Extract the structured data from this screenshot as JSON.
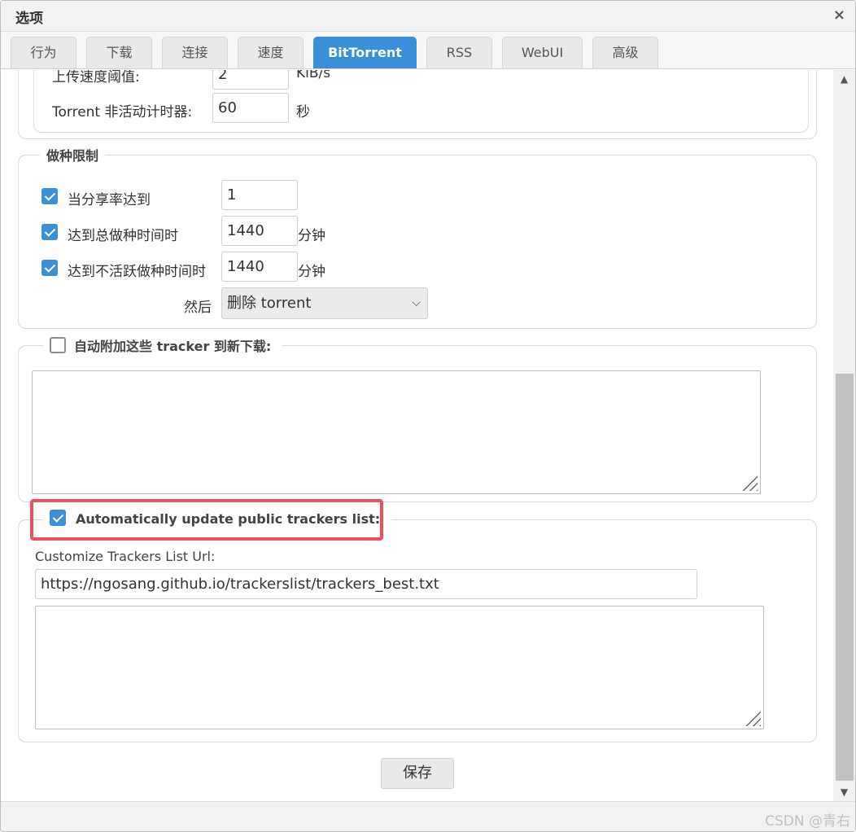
{
  "window": {
    "title": "选项",
    "close_glyph": "×"
  },
  "tabs": [
    {
      "label": "行为"
    },
    {
      "label": "下载"
    },
    {
      "label": "连接"
    },
    {
      "label": "速度"
    },
    {
      "label": "BitTorrent",
      "active": true
    },
    {
      "label": "RSS"
    },
    {
      "label": "WebUI"
    },
    {
      "label": "高级"
    }
  ],
  "torrent_queue": {
    "upload_threshold_label": "上传速度阈值:",
    "upload_threshold_value": "2",
    "upload_threshold_unit": "KiB/s",
    "inactive_timer_label": "Torrent 非活动计时器:",
    "inactive_timer_value": "60",
    "inactive_timer_unit": "秒"
  },
  "seeding_limits": {
    "legend": "做种限制",
    "ratio_label": "当分享率达到",
    "ratio_checked": true,
    "ratio_value": "1",
    "seed_time_label": "达到总做种时间时",
    "seed_time_checked": true,
    "seed_time_value": "1440",
    "seed_time_unit": "分钟",
    "inactive_time_label": "达到不活跃做种时间时",
    "inactive_time_checked": true,
    "inactive_time_value": "1440",
    "inactive_time_unit": "分钟",
    "then_label": "然后",
    "then_action": "删除 torrent"
  },
  "add_trackers": {
    "legend": "自动附加这些 tracker 到新下载:",
    "checked": false,
    "trackers_text": ""
  },
  "public_trackers": {
    "legend": "Automatically update public trackers list:",
    "checked": true,
    "url_label": "Customize Trackers List Url:",
    "url_value": "https://ngosang.github.io/trackerslist/trackers_best.txt",
    "list_text": ""
  },
  "actions": {
    "save_label": "保存"
  },
  "watermark": "CSDN @青右",
  "colors": {
    "accent": "#3b8fd9",
    "highlight": "#ef4f63"
  }
}
